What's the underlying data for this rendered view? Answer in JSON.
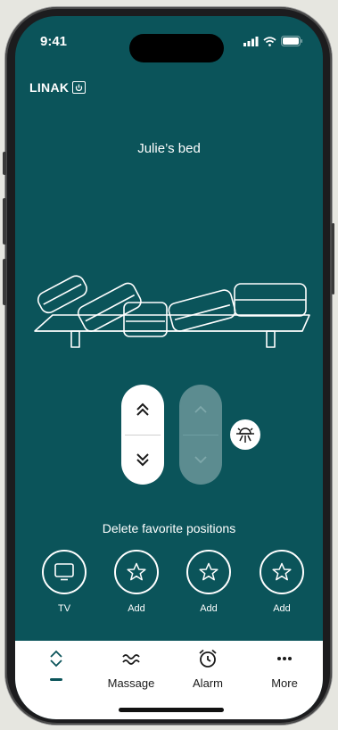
{
  "status_bar": {
    "time": "9:41"
  },
  "brand": {
    "logo_text": "LINAK"
  },
  "bed": {
    "name": "Julie’s bed"
  },
  "favorites": {
    "header": "Delete favorite positions",
    "items": [
      {
        "label": "TV",
        "icon": "tv-icon"
      },
      {
        "label": "Add",
        "icon": "star-icon"
      },
      {
        "label": "Add",
        "icon": "star-icon"
      },
      {
        "label": "Add",
        "icon": "star-icon"
      }
    ]
  },
  "tabs": [
    {
      "label": "",
      "icon": "updown-chevron-icon",
      "active": true
    },
    {
      "label": "Massage",
      "icon": "wave-icon",
      "active": false
    },
    {
      "label": "Alarm",
      "icon": "alarm-clock-icon",
      "active": false
    },
    {
      "label": "More",
      "icon": "more-dots-icon",
      "active": false
    }
  ],
  "colors": {
    "background": "#0b545a",
    "tab_bar": "#ffffff",
    "inactive_pill": "#5c8c90"
  }
}
